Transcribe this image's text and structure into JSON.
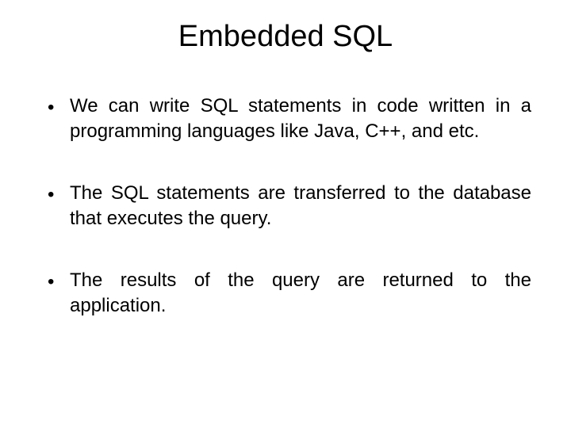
{
  "title": "Embedded SQL",
  "bullets": [
    "We can write SQL statements in code written in a programming languages like Java, C++, and etc.",
    "The SQL statements are transferred to the database that executes the query.",
    "The results of the query are returned to the application."
  ]
}
